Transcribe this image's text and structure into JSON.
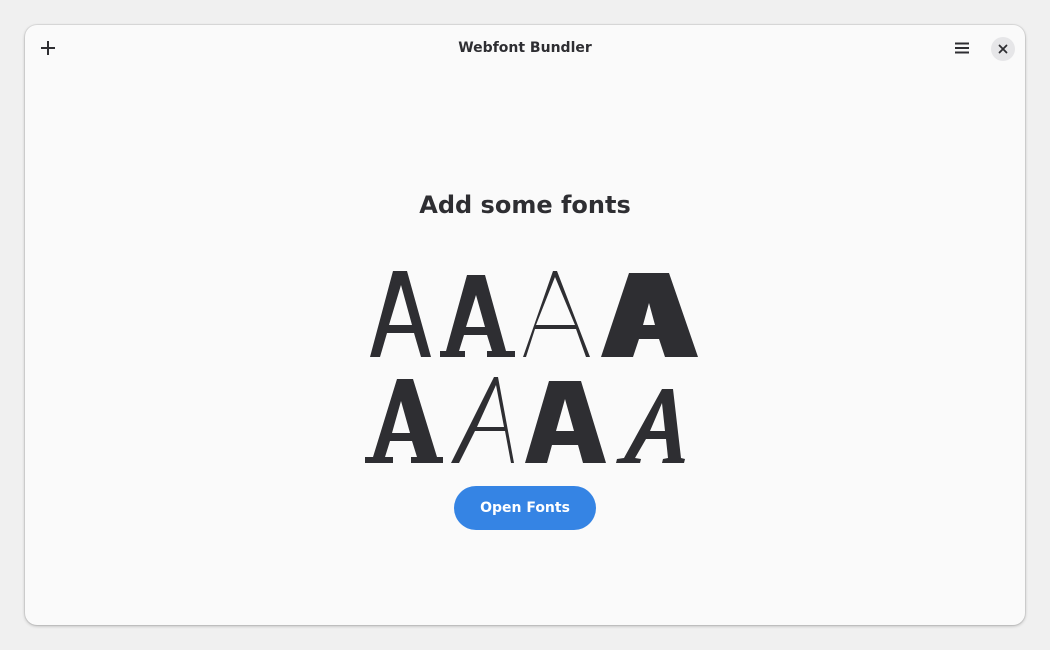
{
  "window": {
    "title": "Webfont Bundler"
  },
  "headerbar": {
    "add_icon": "plus-icon",
    "menu_icon": "hamburger-menu-icon",
    "close_icon": "close-icon"
  },
  "empty_state": {
    "heading": "Add some fonts",
    "illustration_icon": "font-samples-illustration",
    "glyph": "A",
    "open_button_label": "Open Fonts"
  },
  "colors": {
    "accent": "#3584e4",
    "text": "#2e2e32",
    "background": "#fafafa"
  }
}
